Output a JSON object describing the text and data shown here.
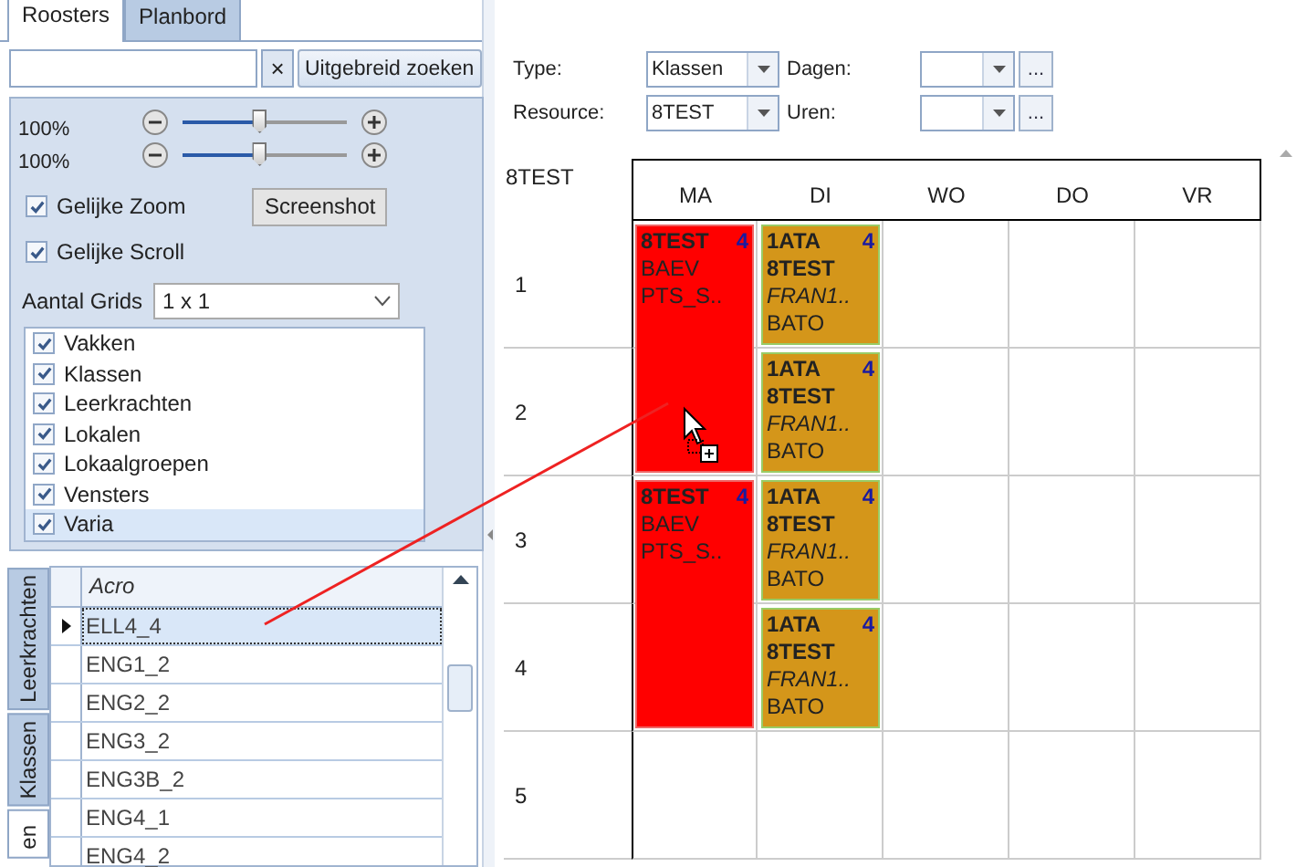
{
  "tabs": [
    {
      "label": "Roosters",
      "selected": true
    },
    {
      "label": "Planbord",
      "selected": false
    }
  ],
  "search": {
    "clear": "×",
    "button": "Uitgebreid zoeken"
  },
  "zoom": {
    "sliders": [
      {
        "reading": "100%",
        "level": 0.47
      },
      {
        "reading": "100%",
        "level": 0.47
      }
    ],
    "checkboxes": [
      {
        "label": "Gelijke Zoom",
        "checked": true
      },
      {
        "label": "Gelijke Scroll",
        "checked": true
      }
    ],
    "screenshot_button": "Screenshot",
    "grids_label": "Aantal Grids",
    "grids_value": "1 x 1",
    "list": [
      {
        "label": "Vakken",
        "checked": true,
        "selected": false
      },
      {
        "label": "Klassen",
        "checked": true,
        "selected": false
      },
      {
        "label": "Leerkrachten",
        "checked": true,
        "selected": false
      },
      {
        "label": "Lokalen",
        "checked": true,
        "selected": false
      },
      {
        "label": "Lokaalgroepen",
        "checked": true,
        "selected": false
      },
      {
        "label": "Vensters",
        "checked": true,
        "selected": false
      },
      {
        "label": "Varia",
        "checked": true,
        "selected": true
      }
    ]
  },
  "side_tabs": [
    {
      "label": "Leerkrachten",
      "selected": false
    },
    {
      "label": "Klassen",
      "selected": false
    },
    {
      "label": "en",
      "selected": true
    }
  ],
  "acro_table": {
    "column": "Acro",
    "rows": [
      {
        "value": "ELL4_4",
        "selected": true
      },
      {
        "value": "ENG1_2",
        "selected": false
      },
      {
        "value": "ENG2_2",
        "selected": false
      },
      {
        "value": "ENG3_2",
        "selected": false
      },
      {
        "value": "ENG3B_2",
        "selected": false
      },
      {
        "value": "ENG4_1",
        "selected": false
      },
      {
        "value": "ENG4_2",
        "selected": false
      }
    ]
  },
  "filters": [
    {
      "label": "Type:",
      "value": "Klassen",
      "label2": "Dagen:",
      "ellipsis": "..."
    },
    {
      "label": "Resource:",
      "value": "8TEST",
      "label2": "Uren:",
      "ellipsis": "..."
    }
  ],
  "timetable": {
    "title": "8TEST",
    "hours": [
      "1",
      "2",
      "3",
      "4",
      "5"
    ],
    "days": [
      {
        "label": "MA",
        "blocks": [
          {
            "kind": "double",
            "color": "#ff0000",
            "count": "4",
            "lines": [
              {
                "text": "8TEST",
                "kind": "bold"
              },
              {
                "text": "BAEV",
                "kind": "plain"
              },
              {
                "text": "PTS_S..",
                "kind": "plain"
              }
            ]
          },
          {
            "kind": "double",
            "color": "#ff0000",
            "count": "4",
            "lines": [
              {
                "text": "8TEST",
                "kind": "bold"
              },
              {
                "text": "BAEV",
                "kind": "plain"
              },
              {
                "text": "PTS_S..",
                "kind": "plain"
              }
            ]
          }
        ]
      },
      {
        "label": "DI",
        "blocks": [
          {
            "kind": "single",
            "color": "#d4961a",
            "count": "4",
            "lines": [
              {
                "text": "1ATA",
                "kind": "bold"
              },
              {
                "text": "8TEST",
                "kind": "bold"
              },
              {
                "text": "FRAN1..",
                "kind": "italic"
              },
              {
                "text": "BATO",
                "kind": "plain"
              }
            ]
          },
          {
            "kind": "single",
            "color": "#d4961a",
            "count": "4",
            "lines": [
              {
                "text": "1ATA",
                "kind": "bold"
              },
              {
                "text": "8TEST",
                "kind": "bold"
              },
              {
                "text": "FRAN1..",
                "kind": "italic"
              },
              {
                "text": "BATO",
                "kind": "plain"
              }
            ]
          },
          {
            "kind": "single",
            "color": "#d4961a",
            "count": "4",
            "lines": [
              {
                "text": "1ATA",
                "kind": "bold"
              },
              {
                "text": "8TEST",
                "kind": "bold"
              },
              {
                "text": "FRAN1..",
                "kind": "italic"
              },
              {
                "text": "BATO",
                "kind": "plain"
              }
            ]
          },
          {
            "kind": "single",
            "color": "#d4961a",
            "count": "4",
            "lines": [
              {
                "text": "1ATA",
                "kind": "bold"
              },
              {
                "text": "8TEST",
                "kind": "bold"
              },
              {
                "text": "FRAN1..",
                "kind": "italic"
              },
              {
                "text": "BATO",
                "kind": "plain"
              }
            ]
          }
        ]
      },
      {
        "label": "WO"
      },
      {
        "label": "DO"
      },
      {
        "label": "VR"
      }
    ]
  }
}
